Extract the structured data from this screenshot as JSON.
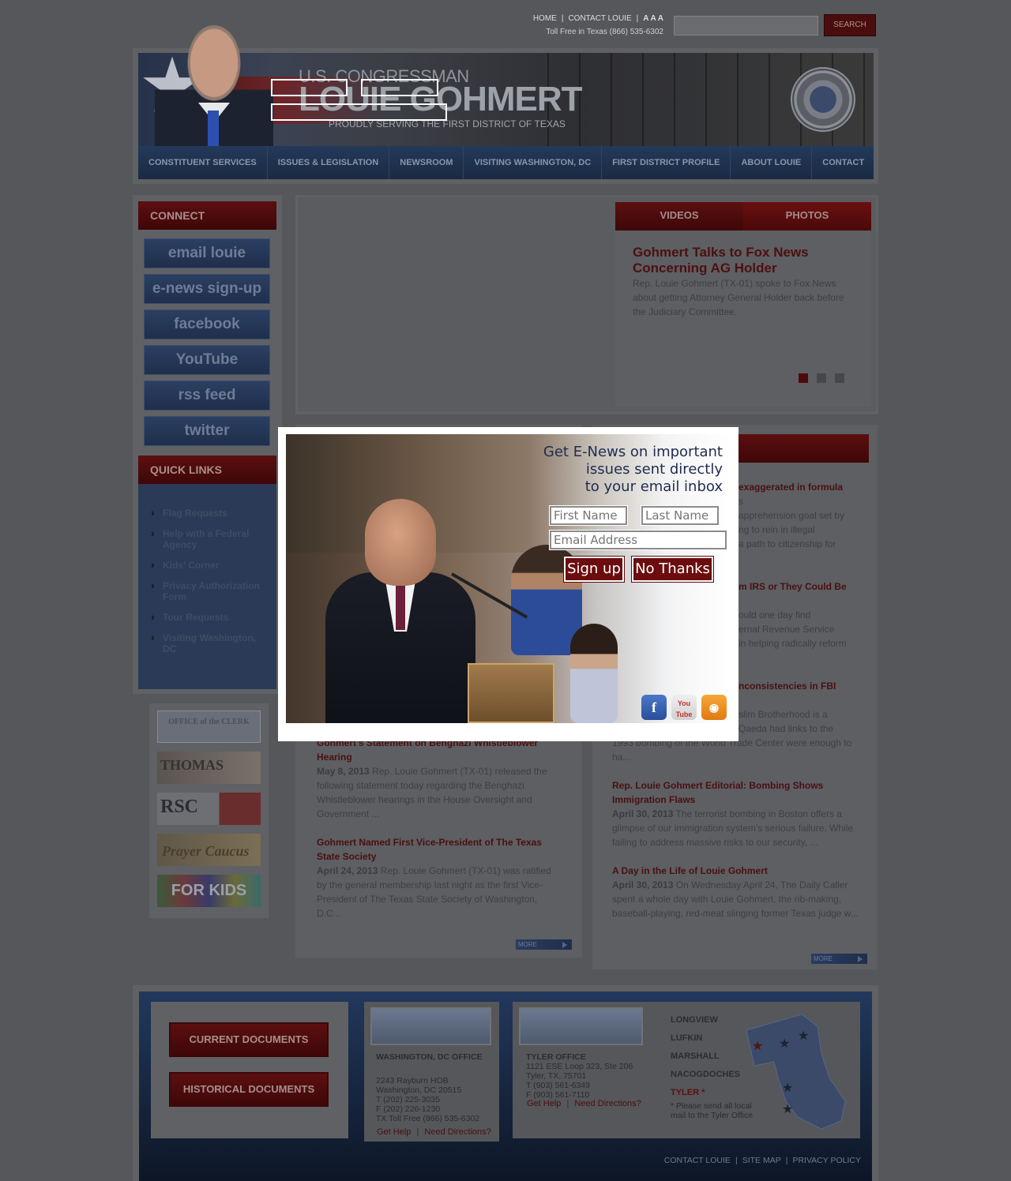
{
  "top_nav": {
    "links": [
      "HOME",
      "CONTACT LOUIE"
    ],
    "text_size_label": "A A A",
    "toll_free": "Toll Free in Texas (866) 535-6302"
  },
  "search": {
    "button_label": "SEARCH",
    "placeholder": ""
  },
  "banner": {
    "line1": "U.S. CONGRESSMAN",
    "line2": "LOUIE GOHMERT",
    "line3": "PROUDLY SERVING THE FIRST DISTRICT OF TEXAS"
  },
  "main_nav": [
    "CONSTITUENT SERVICES",
    "ISSUES & LEGISLATION",
    "NEWSROOM",
    "VISITING WASHINGTON, DC",
    "FIRST DISTRICT PROFILE",
    "ABOUT LOUIE",
    "CONTACT"
  ],
  "connect": {
    "heading": "CONNECT",
    "buttons": [
      "email louie",
      "e-news sign-up",
      "facebook",
      "YouTube",
      "rss feed",
      "twitter"
    ]
  },
  "quick_links": {
    "heading": "QUICK LINKS",
    "items": [
      "Flag Requests",
      "Help with a Federal Agency",
      "Kids' Corner",
      "Privacy Authorization Form",
      "Tour Requests",
      "Visiting Washington, DC"
    ]
  },
  "logo_links": [
    "OFFICE of the CLERK",
    "THOMAS",
    "RSC",
    "Prayer Caucus",
    "FOR KIDS"
  ],
  "media_tabs": [
    "VIDEOS",
    "PHOTOS"
  ],
  "feature": {
    "title": "Gohmert Talks to Fox News Concerning AG Holder",
    "description": "Rep. Louie Gohmert (TX-01) spoke to Fox News about getting Attorney General Holder back before the Judiciary Committee."
  },
  "news_left": [
    {
      "title": "Gohmert's Statement on Benghazi Whistleblower Hearing",
      "date": "May 8, 2013",
      "summary": "Rep. Louie Gohmert (TX-01) released the following statement today regarding the Benghazi Whistleblower hearings in the House Oversight and Government ..."
    },
    {
      "title": "Gohmert Named First Vice-President of The Texas State Society",
      "date": "April 24, 2013",
      "summary": "Rep. Louie Gohmert (TX-01) was ratified by the general membership last night as the first Vice-President of The Texas State Society of Washington, D.C..."
    }
  ],
  "news_right_partial": [
    {
      "title_fragment": "exaggerated in formula",
      "fragment2": "s",
      "lines": [
        "apprehension goal set by",
        "ng to rein in illegal",
        "a path to citizenship for"
      ]
    },
    {
      "title_fragment": "m IRS or They Could Be",
      "lines": [
        "ould one day find",
        "ernal Revenue Service",
        "in helping radically reform"
      ]
    },
    {
      "title_fragment": "nconsistencies in FBI",
      "lines": [
        "slim Brotherhood is a",
        "Qaeda had links to the",
        "1993 bombing of the World Trade Center were enough to",
        "ha..."
      ]
    }
  ],
  "news_right": [
    {
      "title": "Rep. Louie Gohmert Editorial: Bombing Shows Immigration Flaws",
      "date": "April 30, 2013",
      "summary": "The terrorist bombing in Boston offers a glimpse of our immigration system's serious failure. While failing to address massive risks to our security, ..."
    },
    {
      "title": "A Day in the Life of Louie Gohmert",
      "date": "April 30, 2013",
      "summary": "On Wednesday April 24, The Daily Caller spent a whole day with Louie Gohmert, the rib-making, baseball-playing, red-meat slinging former Texas judge w..."
    }
  ],
  "more_label": "MORE",
  "footer": {
    "doc_buttons": [
      "CURRENT DOCUMENTS",
      "HISTORICAL DOCUMENTS"
    ],
    "dc_office": {
      "title": "WASHINGTON, DC OFFICE",
      "lines": [
        "2243 Rayburn HOB",
        "Washington, DC 20515",
        "T (202) 225-3035",
        "F (202) 226-1230",
        "TX Toll Free (866) 535-6302"
      ],
      "links": [
        "Get Help",
        "Need Directions?"
      ]
    },
    "tyler_office": {
      "title": "TYLER OFFICE",
      "lines": [
        "1121 ESE Loop 323, Ste 206",
        "Tyler, TX, 75701",
        "T (903) 561-6349",
        "F (903) 561-7110"
      ],
      "links": [
        "Get Help",
        "Need Directions?"
      ]
    },
    "cities": [
      "LONGVIEW",
      "LUFKIN",
      "MARSHALL",
      "NACOGDOCHES",
      "TYLER *"
    ],
    "mail_note": "* Please send all local mail to the Tyler Office",
    "links": [
      "CONTACT LOUIE",
      "SITE MAP",
      "PRIVACY POLICY"
    ]
  },
  "popup": {
    "headline_lines": [
      "Get E-News on important",
      "issues sent directly",
      "to your email inbox"
    ],
    "first_name_placeholder": "First Name",
    "last_name_placeholder": "Last Name",
    "email_placeholder": "Email Address",
    "signup_label": "Sign up",
    "no_thanks_label": "No Thanks",
    "social_icons": [
      "facebook-icon",
      "youtube-icon",
      "rss-icon"
    ]
  },
  "colors": {
    "accent_red": "#6b0d0f",
    "nav_blue": "#1a2a42",
    "overlay_gray": "#55575a"
  }
}
